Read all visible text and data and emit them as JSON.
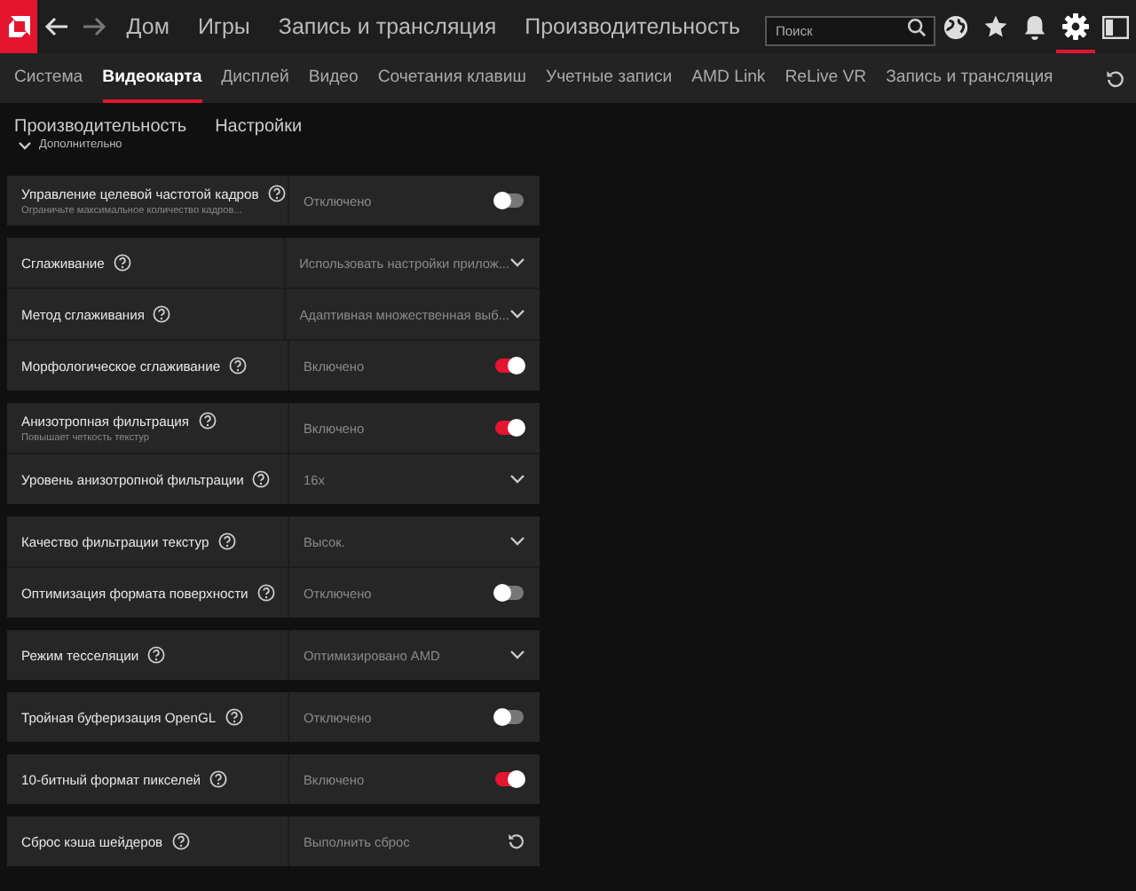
{
  "top_bar": {
    "nav": [
      {
        "label": "Дом"
      },
      {
        "label": "Игры"
      },
      {
        "label": "Запись и трансляция"
      },
      {
        "label": "Производительность"
      }
    ],
    "back_disabled": false,
    "forward_disabled": true,
    "search": {
      "placeholder": "Поиск"
    },
    "icons": [
      {
        "kind": "globe",
        "selected": false
      },
      {
        "kind": "star",
        "selected": false
      },
      {
        "kind": "bell",
        "selected": false
      },
      {
        "kind": "gear",
        "selected": true
      },
      {
        "kind": "panel",
        "selected": false
      }
    ]
  },
  "tabs": [
    {
      "label": "Система",
      "selected": false
    },
    {
      "label": "Видеокарта",
      "selected": true
    },
    {
      "label": "Дисплей",
      "selected": false
    },
    {
      "label": "Видео",
      "selected": false
    },
    {
      "label": "Сочетания клавиш",
      "selected": false
    },
    {
      "label": "Учетные записи",
      "selected": false
    },
    {
      "label": "AMD Link",
      "selected": false
    },
    {
      "label": "ReLive VR",
      "selected": false
    },
    {
      "label": "Запись и трансляция",
      "selected": false
    }
  ],
  "subnav": [
    {
      "label": "Производительность"
    },
    {
      "label": "Настройки"
    }
  ],
  "advanced": {
    "label": "Дополнительно",
    "expanded": false
  },
  "groups": [
    [
      {
        "kind": "toggle",
        "label": "Управление целевой частотой кадров",
        "subtitle": "Ограничьте максимальное количество кадров...",
        "value": "Отключено",
        "on": false
      }
    ],
    [
      {
        "kind": "dropdown",
        "label": "Сглаживание",
        "value": "Использовать настройки прилож..."
      },
      {
        "kind": "dropdown",
        "label": "Метод сглаживания",
        "value": "Адаптивная множественная выб..."
      },
      {
        "kind": "toggle",
        "label": "Морфологическое сглаживание",
        "value": "Включено",
        "on": true
      }
    ],
    [
      {
        "kind": "toggle",
        "label": "Анизотропная фильтрация",
        "subtitle": "Повышает четкость текстур",
        "value": "Включено",
        "on": true
      },
      {
        "kind": "dropdown",
        "label": "Уровень анизотропной фильтрации",
        "value": "16x"
      }
    ],
    [
      {
        "kind": "dropdown",
        "label": "Качество фильтрации текстур",
        "value": "Высок."
      },
      {
        "kind": "toggle",
        "label": "Оптимизация формата поверхности",
        "value": "Отключено",
        "on": false
      }
    ],
    [
      {
        "kind": "dropdown",
        "label": "Режим тесселяции",
        "value": "Оптимизировано AMD"
      }
    ],
    [
      {
        "kind": "toggle",
        "label": "Тройная буферизация OpenGL",
        "value": "Отключено",
        "on": false
      }
    ],
    [
      {
        "kind": "toggle",
        "label": "10-битный формат пикселей",
        "value": "Включено",
        "on": true
      }
    ],
    [
      {
        "kind": "reset",
        "label": "Сброс кэша шейдеров",
        "value": "Выполнить сброс"
      }
    ]
  ]
}
